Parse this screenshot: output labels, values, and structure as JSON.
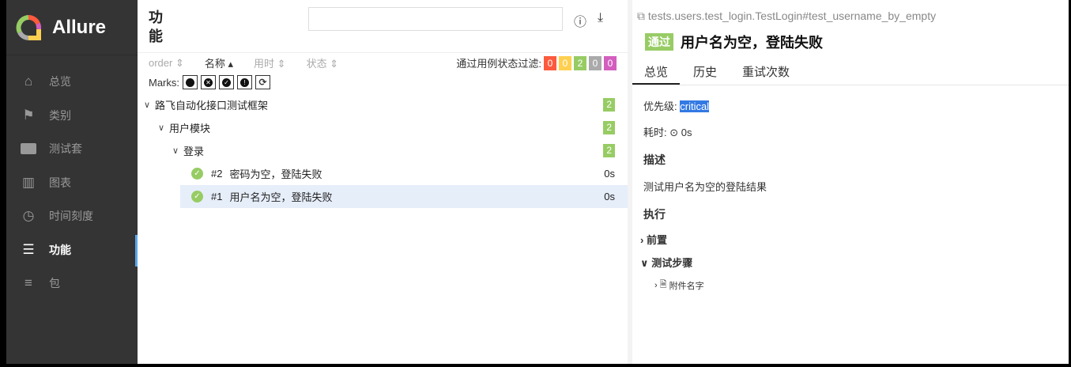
{
  "sidebar": {
    "brand": "Allure",
    "items": [
      {
        "label": "总览",
        "icon": "home-icon"
      },
      {
        "label": "类别",
        "icon": "flag-icon"
      },
      {
        "label": "测试套",
        "icon": "briefcase-icon"
      },
      {
        "label": "图表",
        "icon": "bar-chart-icon"
      },
      {
        "label": "时间刻度",
        "icon": "clock-icon"
      },
      {
        "label": "功能",
        "icon": "list-icon",
        "active": true
      },
      {
        "label": "包",
        "icon": "align-left-icon"
      }
    ]
  },
  "main": {
    "title": "功能",
    "sort": [
      "order",
      "名称",
      "用时",
      "状态"
    ],
    "filter_label": "通过用例状态过滤:",
    "filters": [
      {
        "v": "0",
        "color": "#fd5a3e"
      },
      {
        "v": "0",
        "color": "#ffd050"
      },
      {
        "v": "2",
        "color": "#97cc64"
      },
      {
        "v": "0",
        "color": "#aaaaaa"
      },
      {
        "v": "0",
        "color": "#d35ebe"
      }
    ],
    "marks_label": "Marks:",
    "tree": [
      {
        "label": "路飞自动化接口测试框架",
        "count": "2"
      },
      {
        "label": "用户模块",
        "count": "2"
      },
      {
        "label": "登录",
        "count": "2"
      }
    ],
    "cases": [
      {
        "num": "#2",
        "name": "密码为空，登陆失败",
        "dur": "0s"
      },
      {
        "num": "#1",
        "name": "用户名为空，登陆失败",
        "dur": "0s"
      }
    ]
  },
  "detail": {
    "uid": "tests.users.test_login.TestLogin#test_username_by_empty",
    "status": "通过",
    "title": "用户名为空，登陆失败",
    "tabs": [
      "总览",
      "历史",
      "重试次数"
    ],
    "severity_label": "优先级:",
    "severity": "critical",
    "duration_label": "耗时:",
    "duration": "0s",
    "desc_title": "描述",
    "desc": "测试用户名为空的登陆结果",
    "exec_title": "执行",
    "setup": "前置",
    "steps": "测试步骤",
    "attachment": "附件名字"
  }
}
